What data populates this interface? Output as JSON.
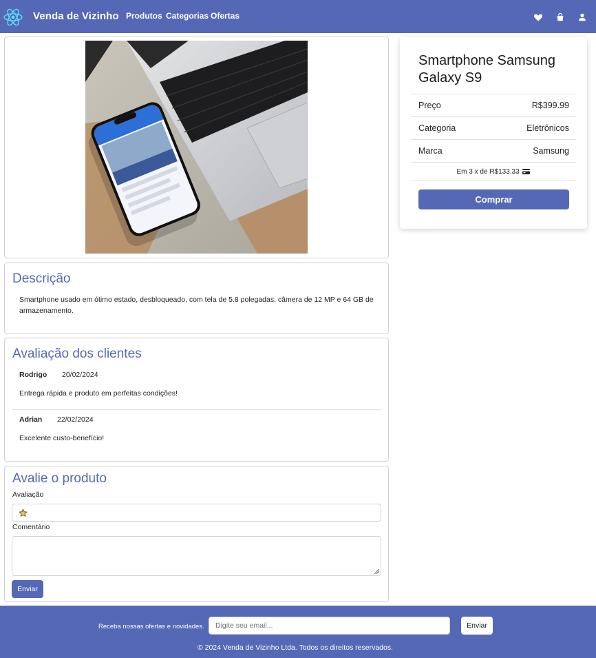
{
  "navbar": {
    "brand": "Venda de Vizinho",
    "links": [
      "Produtos",
      "Categorias",
      "Ofertas"
    ],
    "icons": [
      "heart-icon",
      "shopping-bag-icon",
      "user-icon"
    ],
    "color": "#5468b6"
  },
  "product": {
    "image": "photo-laptop-and-smartphone",
    "title": "Smartphone Samsung Galaxy S9",
    "rows": [
      {
        "label": "Preço",
        "value": "R$399.99"
      },
      {
        "label": "Categoria",
        "value": "Eletrônicos"
      },
      {
        "label": "Marca",
        "value": "Samsung"
      }
    ],
    "installments": "Em 3 x de R$133.33",
    "installments_icon": "credit-card-icon",
    "buy_label": "Comprar"
  },
  "description": {
    "title": "Descrição",
    "text": "Smartphone usado em ótimo estado, desbloqueado, com tela de 5.8 polegadas, câmera de 12 MP e 64 GB de armazenamento."
  },
  "reviews": {
    "title": "Avaliação dos clientes",
    "items": [
      {
        "name": "Rodrigo",
        "date": "20/02/2024",
        "text": "Entrega rápida e produto em perfeitas condições!"
      },
      {
        "name": "Adrian",
        "date": "22/02/2024",
        "text": "Excelente custo-benefício!"
      }
    ]
  },
  "review_form": {
    "title": "Avalie o produto",
    "rating_label": "Avaliação",
    "rating_icon": "star-icon",
    "comment_label": "Comentário",
    "submit_label": "Enviar"
  },
  "footer": {
    "newsletter_text": "Receba nossas ofertas e novidades.",
    "email_placeholder": "Digite seu email...",
    "submit_label": "Enviar",
    "copyright": "© 2024 Venda de Vizinho Ltda. Todos os direitos reservados."
  }
}
